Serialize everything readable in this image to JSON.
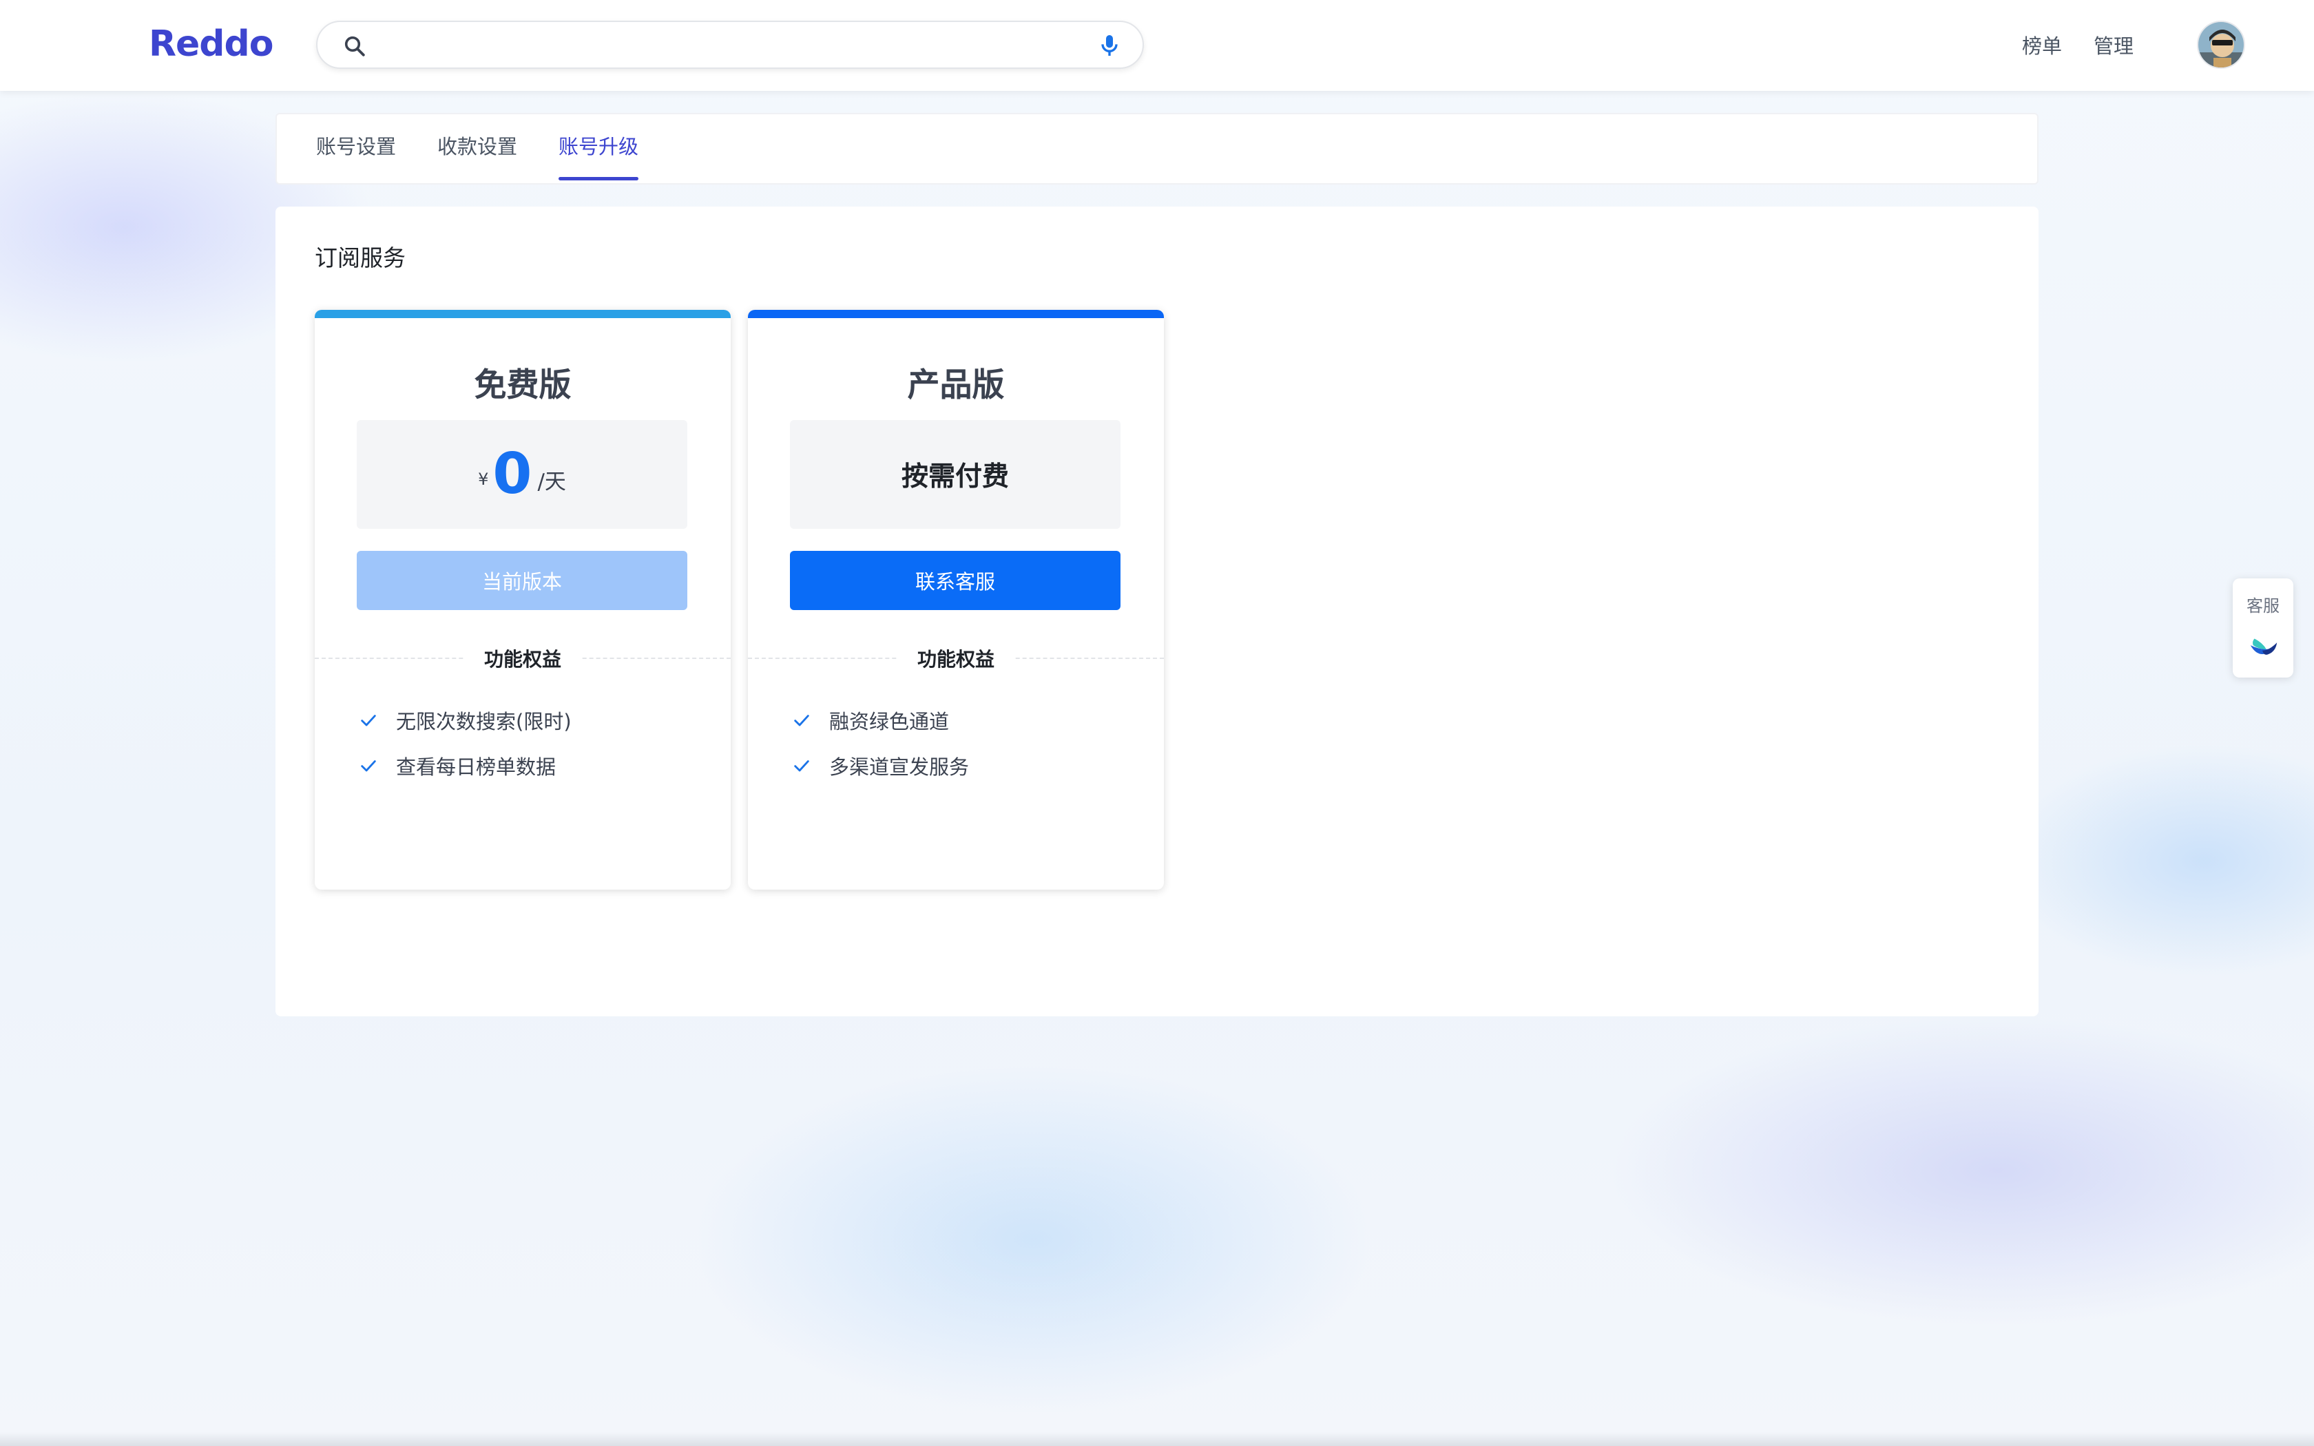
{
  "header": {
    "logo": "Reddo",
    "search": {
      "value": "",
      "placeholder": ""
    },
    "nav": {
      "rankings": "榜单",
      "admin": "管理"
    }
  },
  "tabs": [
    {
      "label": "账号设置",
      "active": false
    },
    {
      "label": "收款设置",
      "active": false
    },
    {
      "label": "账号升级",
      "active": true
    }
  ],
  "panel": {
    "title": "订阅服务",
    "plans": [
      {
        "name": "免费版",
        "price_currency": "¥",
        "price_amount": "0",
        "price_unit": "/天",
        "button_label": "当前版本",
        "button_disabled": true,
        "benefits_heading": "功能权益",
        "features": [
          "无限次数搜索(限时)",
          "查看每日榜单数据"
        ],
        "accent": "#2aa0e6"
      },
      {
        "name": "产品版",
        "price_text": "按需付费",
        "button_label": "联系客服",
        "button_disabled": false,
        "benefits_heading": "功能权益",
        "features": [
          "融资绿色通道",
          "多渠道宣发服务"
        ],
        "accent": "#0a66f5"
      }
    ]
  },
  "support_widget": {
    "label": "客服"
  },
  "colors": {
    "brand": "#3d45cf",
    "primary_button": "#0a6cf7",
    "disabled_button": "#9ec5fa",
    "price": "#1771f1",
    "check": "#1a73e8"
  }
}
